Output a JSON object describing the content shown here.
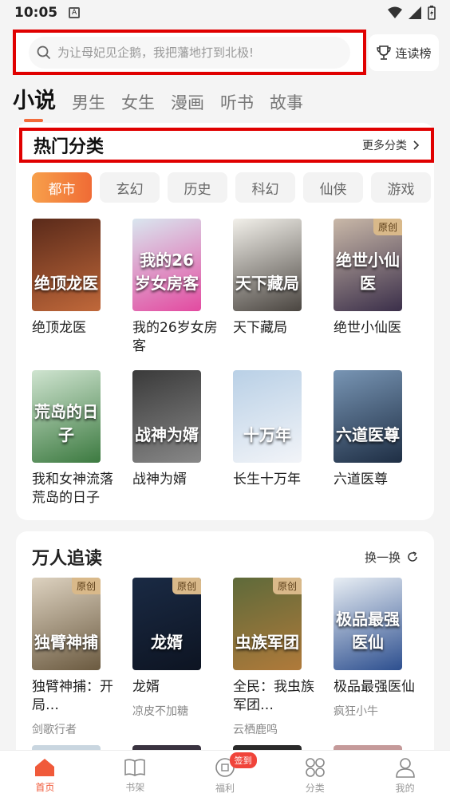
{
  "status": {
    "time": "10:05",
    "badge": "A"
  },
  "search": {
    "placeholder": "为让母妃见企鹅，我把藩地打到北极!"
  },
  "rank_button": {
    "label": "连读榜"
  },
  "tabs": [
    {
      "label": "小说"
    },
    {
      "label": "男生"
    },
    {
      "label": "女生"
    },
    {
      "label": "漫画"
    },
    {
      "label": "听书"
    },
    {
      "label": "故事"
    }
  ],
  "hot": {
    "title": "热门分类",
    "more": "更多分类",
    "chips": [
      {
        "label": "都市"
      },
      {
        "label": "玄幻"
      },
      {
        "label": "历史"
      },
      {
        "label": "科幻"
      },
      {
        "label": "仙侠"
      },
      {
        "label": "游戏"
      }
    ],
    "books": [
      {
        "title": "绝顶龙医",
        "cover_text": "绝顶龙医",
        "c1": "#5a2a1a",
        "c2": "#c0683a"
      },
      {
        "title": "我的26岁女房客",
        "cover_text": "我的26岁女房客",
        "c1": "#d9e6ef",
        "c2": "#e34aa0"
      },
      {
        "title": "天下藏局",
        "cover_text": "天下藏局",
        "c1": "#f2f0ea",
        "c2": "#4a4540"
      },
      {
        "title": "绝世小仙医",
        "cover_text": "绝世小仙医",
        "tag": "原创",
        "c1": "#c9b8a8",
        "c2": "#3b2f4a"
      },
      {
        "title": "我和女神流落荒岛的日子",
        "cover_text": "荒岛的日子",
        "c1": "#cfe4d0",
        "c2": "#3c7a40"
      },
      {
        "title": "战神为婿",
        "cover_text": "战神为婿",
        "c1": "#3a3a3a",
        "c2": "#888"
      },
      {
        "title": "长生十万年",
        "cover_text": "十万年",
        "c1": "#b9d0e6",
        "c2": "#f2f4f8"
      },
      {
        "title": "六道医尊",
        "cover_text": "六道医尊",
        "c1": "#7895b4",
        "c2": "#1e2e44"
      }
    ]
  },
  "popular": {
    "title": "万人追读",
    "more": "换一换",
    "books": [
      {
        "title": "独臂神捕：开局…",
        "author": "剑歌行者",
        "cover_text": "独臂神捕",
        "tag": "原创",
        "c1": "#ddd2c0",
        "c2": "#6b5a40"
      },
      {
        "title": "龙婿",
        "author": "凉皮不加糖",
        "cover_text": "龙婿",
        "tag": "原创",
        "c1": "#1a2a44",
        "c2": "#0d1422"
      },
      {
        "title": "全民：我虫族军团…",
        "author": "云栖鹿鸣",
        "cover_text": "虫族军团",
        "tag": "原创",
        "c1": "#5e6a3a",
        "c2": "#b07a3a"
      },
      {
        "title": "极品最强医仙",
        "author": "疯狂小牛",
        "cover_text": "极品最强医仙",
        "c1": "#e8eef4",
        "c2": "#2d4f8f"
      }
    ]
  },
  "tabbar": [
    {
      "label": "首页",
      "icon": "home-icon"
    },
    {
      "label": "书架",
      "icon": "bookshelf-icon"
    },
    {
      "label": "福利",
      "icon": "gift-icon",
      "badge": "签到"
    },
    {
      "label": "分类",
      "icon": "category-icon"
    },
    {
      "label": "我的",
      "icon": "profile-icon"
    }
  ]
}
